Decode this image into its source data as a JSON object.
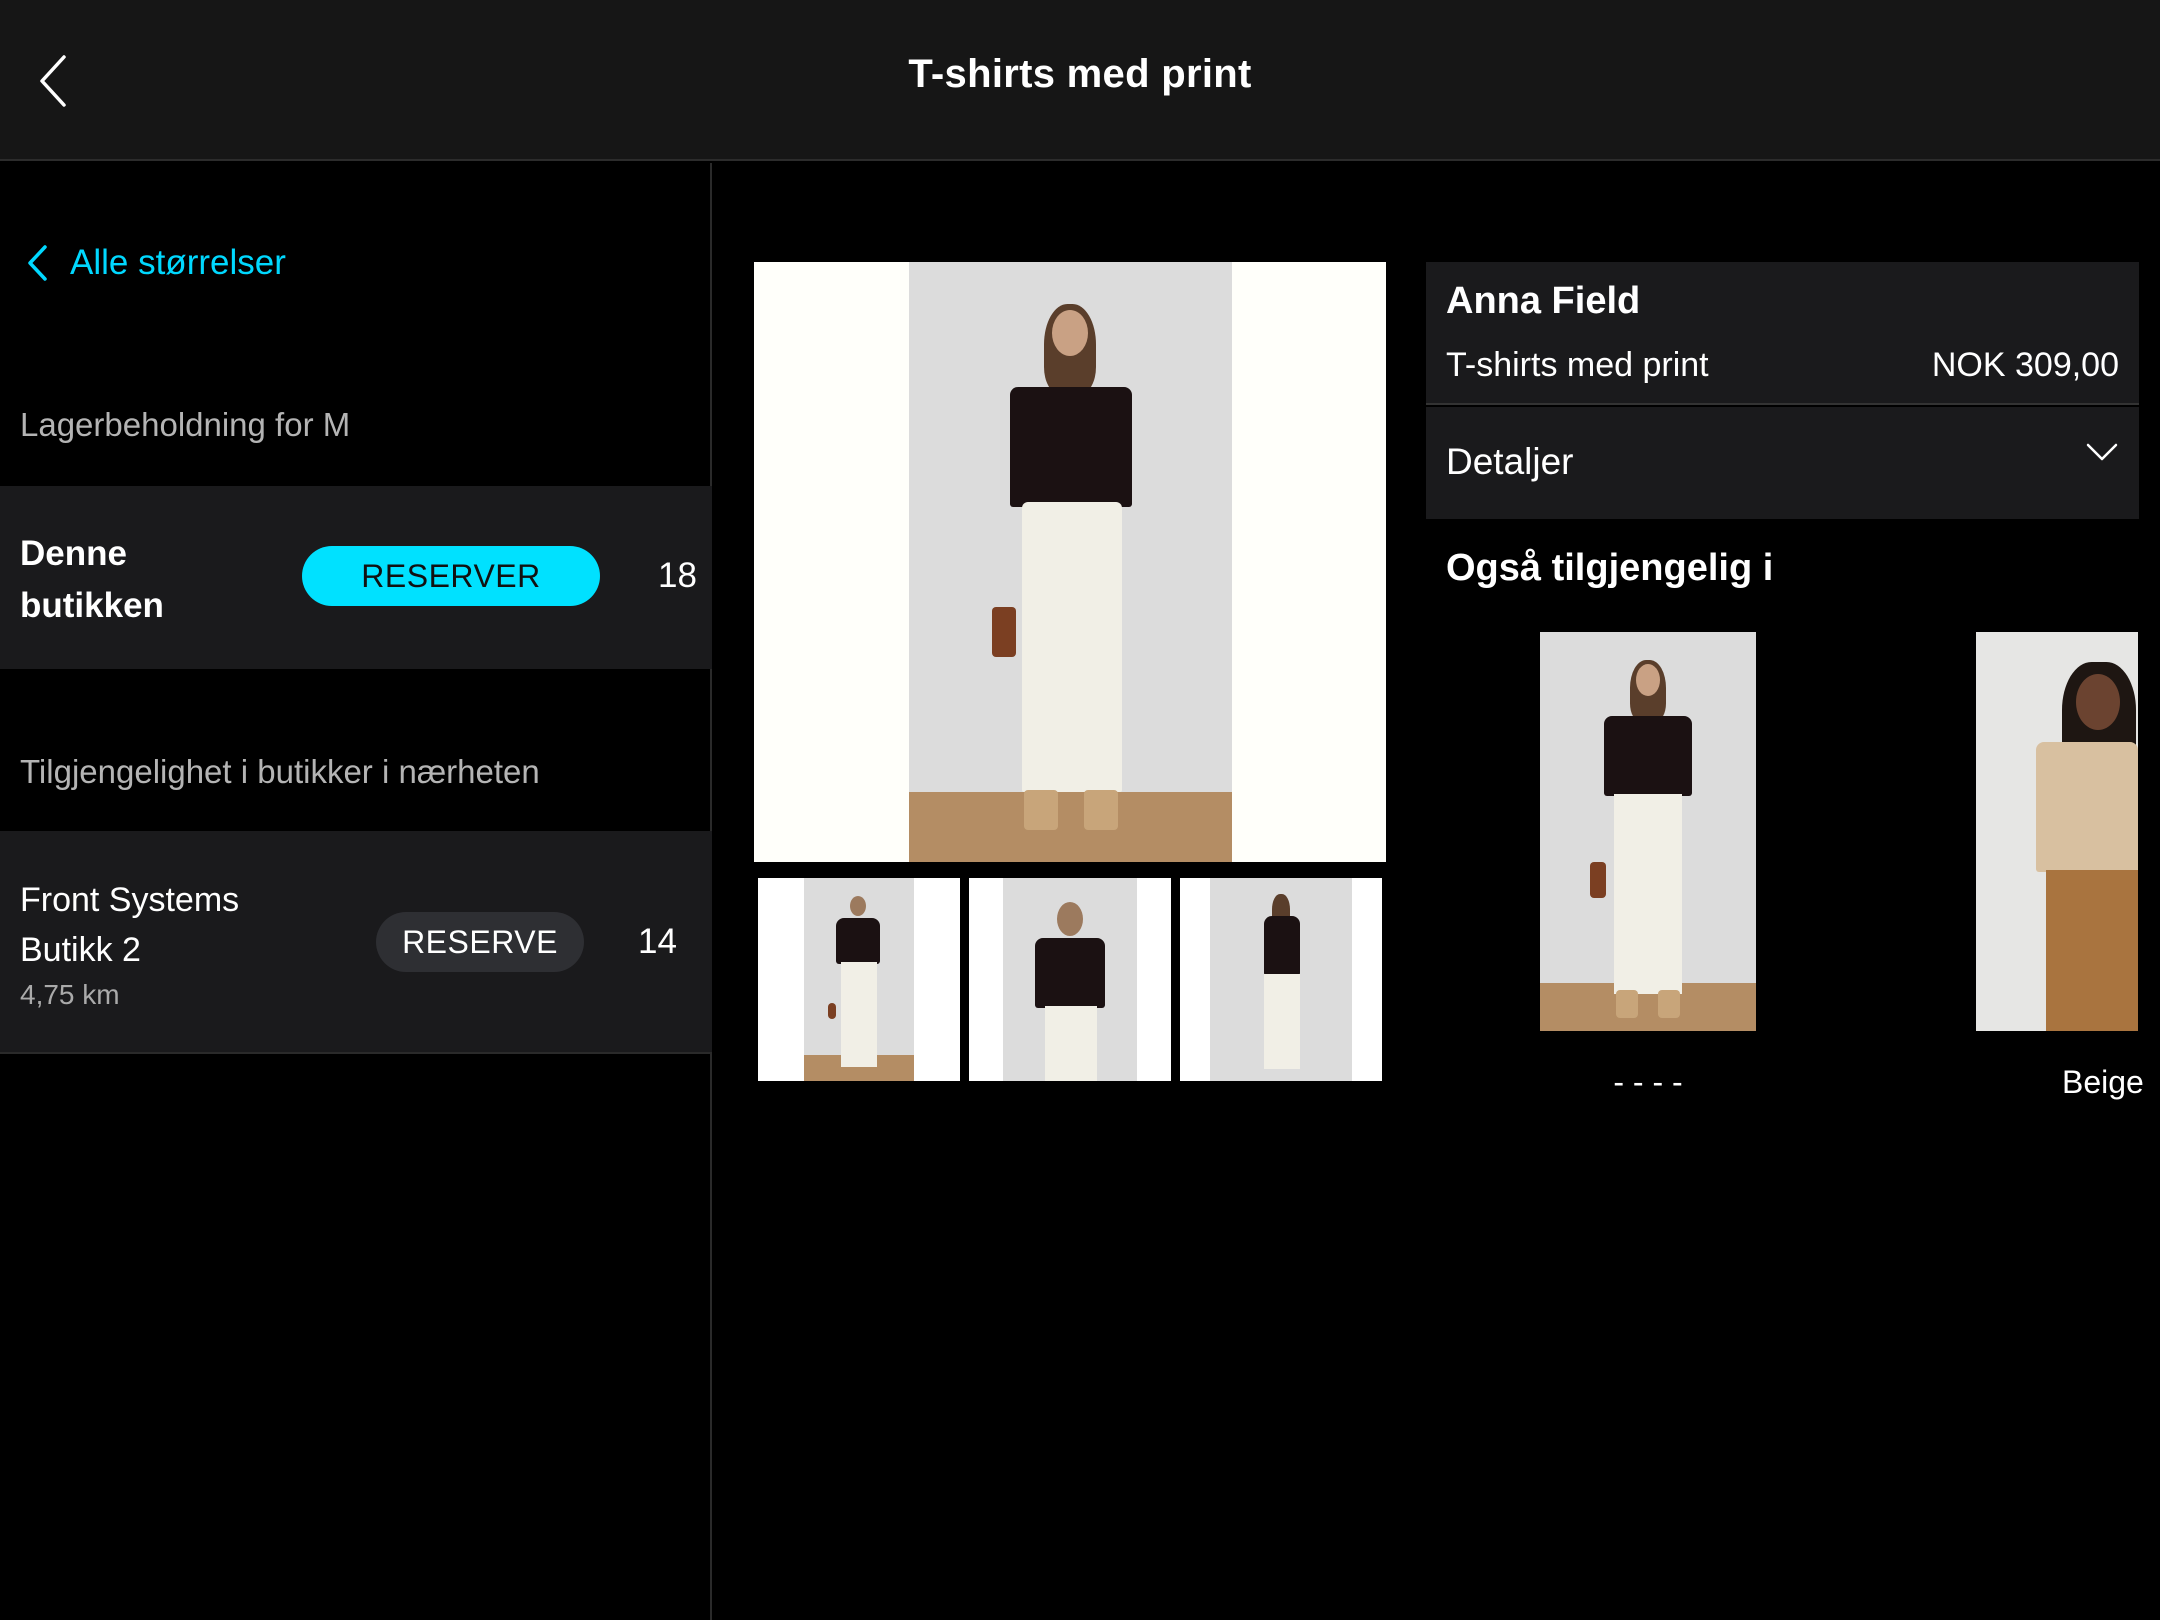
{
  "header": {
    "title": "T-shirts med print",
    "back_icon": "chevron-left-icon"
  },
  "left_panel": {
    "all_sizes_label": "Alle størrelser",
    "stock_label": "Lagerbeholdning for M",
    "this_store": {
      "name": "Denne butikken",
      "reserve_label": "RESERVER",
      "quantity": "18"
    },
    "nearby_label": "Tilgjengelighet i butikker i nærheten",
    "nearby_stores": [
      {
        "name": "Front Systems Butikk 2",
        "distance": "4,75 km",
        "reserve_label": "RESERVE",
        "quantity": "14"
      }
    ]
  },
  "product": {
    "brand": "Anna Field",
    "name": "T-shirts med print",
    "price": "NOK 309,00",
    "details_label": "Detaljer",
    "also_available_title": "Også tilgjengelig i",
    "variants": [
      {
        "label": "- - - -"
      },
      {
        "label": "Beige"
      }
    ]
  },
  "colors": {
    "accent": "#00e1ff",
    "background": "#000000",
    "panel": "#1a1a1c",
    "header": "#161616"
  }
}
